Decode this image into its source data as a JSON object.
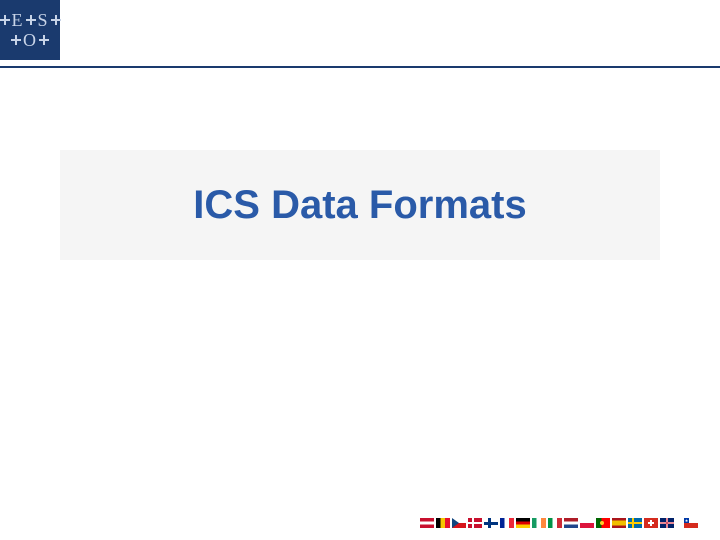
{
  "logo": {
    "line1_left": "E",
    "line1_right": "S",
    "line2": "O"
  },
  "title": "ICS Data Formats",
  "flags": [
    "aut",
    "bel",
    "cze",
    "dnk",
    "fin",
    "fra",
    "deu",
    "irl",
    "ita",
    "nld",
    "pol",
    "prt",
    "esp",
    "swe",
    "che",
    "gbr",
    "gap",
    "chl"
  ]
}
